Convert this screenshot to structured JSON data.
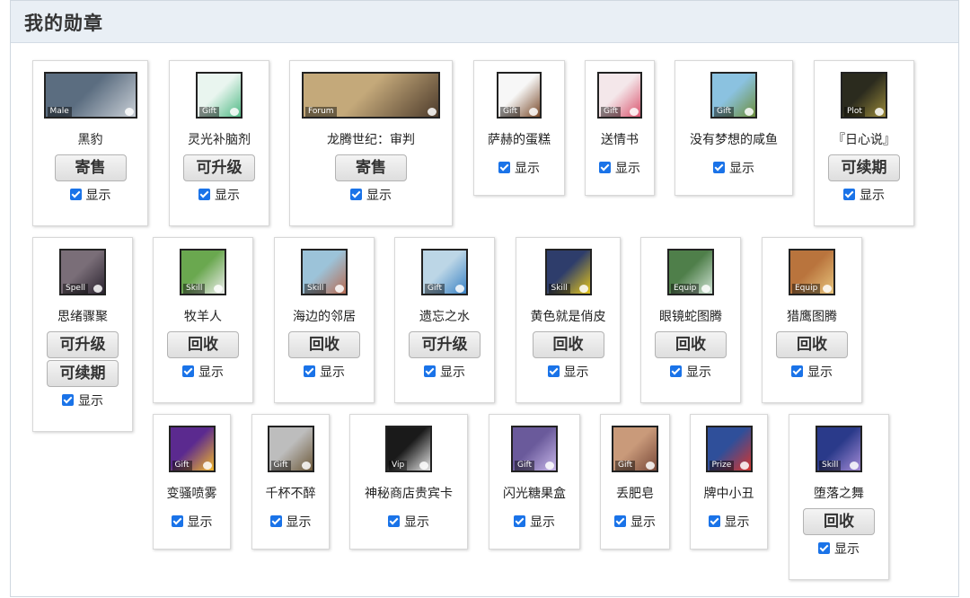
{
  "panel": {
    "title": "我的勋章"
  },
  "show_label": "显示",
  "medals": [
    {
      "name": "黑豹",
      "tag": "Male",
      "buttons": [
        "寄售"
      ],
      "colors": [
        "#5b6d80",
        "#c9cfd6"
      ]
    },
    {
      "name": "灵光补脑剂",
      "tag": "Gift",
      "buttons": [
        "可升级"
      ],
      "colors": [
        "#e9f5ef",
        "#4fb985"
      ]
    },
    {
      "name": "龙腾世纪：审判",
      "tag": "Forum",
      "buttons": [
        "寄售"
      ],
      "colors": [
        "#c4a97a",
        "#4e3c2c"
      ]
    },
    {
      "name": "萨赫的蛋糕",
      "tag": "Gift",
      "buttons": [],
      "colors": [
        "#f7f7f7",
        "#7a4a2a"
      ]
    },
    {
      "name": "送情书",
      "tag": "Gift",
      "buttons": [],
      "colors": [
        "#f4e7ea",
        "#d9546e"
      ]
    },
    {
      "name": "没有梦想的咸鱼",
      "tag": "Gift",
      "buttons": [],
      "colors": [
        "#8bc2e0",
        "#6d8f3c"
      ]
    },
    {
      "name": "『日心说』",
      "tag": "Plot",
      "buttons": [
        "可续期"
      ],
      "colors": [
        "#2b2b1e",
        "#9a8a3a"
      ]
    },
    {
      "name": "思绪骤聚",
      "tag": "Spell",
      "buttons": [
        "可升级",
        "可续期"
      ],
      "colors": [
        "#7a6e78",
        "#2b2430"
      ]
    },
    {
      "name": "牧羊人",
      "tag": "Skill",
      "buttons": [
        "回收"
      ],
      "colors": [
        "#6aa84f",
        "#eeeeee"
      ]
    },
    {
      "name": "海边的邻居",
      "tag": "Skill",
      "buttons": [
        "回收"
      ],
      "colors": [
        "#9cc3d9",
        "#b76b52"
      ]
    },
    {
      "name": "遗忘之水",
      "tag": "Gift",
      "buttons": [
        "可升级"
      ],
      "colors": [
        "#bcd6e6",
        "#3a82c4"
      ]
    },
    {
      "name": "黄色就是俏皮",
      "tag": "Skill",
      "buttons": [
        "回收"
      ],
      "colors": [
        "#2e3d6b",
        "#e6c619"
      ]
    },
    {
      "name": "眼镜蛇图腾",
      "tag": "Equip",
      "buttons": [
        "回收"
      ],
      "colors": [
        "#4f7f4a",
        "#cfe3d4"
      ]
    },
    {
      "name": "猎鹰图腾",
      "tag": "Equip",
      "buttons": [
        "回收"
      ],
      "colors": [
        "#b9743d",
        "#e7c47c"
      ]
    },
    {
      "name": "变骚喷雾",
      "tag": "Gift",
      "buttons": [],
      "colors": [
        "#5b2a8f",
        "#f2b72a"
      ]
    },
    {
      "name": "千杯不醉",
      "tag": "Gift",
      "buttons": [],
      "colors": [
        "#bdbdbd",
        "#6e5a3a"
      ]
    },
    {
      "name": "神秘商店贵宾卡",
      "tag": "Vip",
      "buttons": [],
      "colors": [
        "#1a1a1a",
        "#e6e6e6"
      ]
    },
    {
      "name": "闪光糖果盒",
      "tag": "Gift",
      "buttons": [],
      "colors": [
        "#6a5a9b",
        "#c7b6e8"
      ]
    },
    {
      "name": "丢肥皂",
      "tag": "Gift",
      "buttons": [],
      "colors": [
        "#c99a7a",
        "#7a4a3a"
      ]
    },
    {
      "name": "牌中小丑",
      "tag": "Prize",
      "buttons": [],
      "colors": [
        "#2f4f9a",
        "#d6352e"
      ]
    },
    {
      "name": "堕落之舞",
      "tag": "Skill",
      "buttons": [
        "回收"
      ],
      "colors": [
        "#2a3a8a",
        "#a58bd6"
      ]
    }
  ]
}
